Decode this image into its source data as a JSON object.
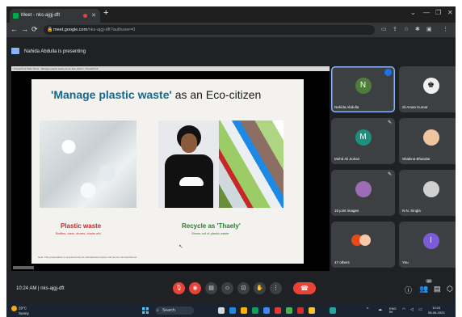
{
  "browser": {
    "tab_title": "Meet - nks-ajgj-dft",
    "new_tab": "+",
    "window_controls": [
      "⌄",
      "—",
      "❐",
      "✕"
    ],
    "nav": [
      "←",
      "→",
      "⟳"
    ],
    "url_host": "meet.google.com",
    "url_path": "/nks-ajgj-dft?authuser=0",
    "extensions": [
      "cast-icon",
      "share-icon",
      "star-icon",
      "extensions-icon",
      "sidebar-icon",
      "menu-icon"
    ]
  },
  "presenting": {
    "text": "Nahida Abdulla is presenting"
  },
  "screen": {
    "ppt_header": "PowerPoint Slide Show - Manage plastic waste as an Eco-citizen - PowerPoint",
    "slide": {
      "title_highlight": "'Manage plastic waste'",
      "title_rest": " as an Eco-citizen",
      "label_plastic": "Plastic waste",
      "sub_plastic": "Bottles, cans, drums, chairs etc.",
      "label_recycle": "Recycle as 'Thaely'",
      "sub_recycle": "Shoes out of plastic waste",
      "footnote": "Note: This presentation is prepared only for educational purpose and not for commercial use"
    }
  },
  "participants": [
    {
      "name": "Nahida Abdulla",
      "initial": "N",
      "color": "#4e7d3a",
      "active": true,
      "speaking": true
    },
    {
      "name": "Sl.Aman Kumar",
      "initial": "",
      "color": "#f0f0f0",
      "photo": true
    },
    {
      "name": "Mohd Ali Zuhair",
      "initial": "M",
      "color": "#1e8e7e"
    },
    {
      "name": "Shakina Bhandar",
      "initial": "",
      "color": "#efc5a0",
      "photo": true
    },
    {
      "name": "15 joint images",
      "initial": "",
      "color": "#9e6bb5",
      "photo": true
    },
    {
      "name": "N.N. Singla",
      "initial": "",
      "color": "#d0d0d0",
      "photo": true
    },
    {
      "name": "47 others",
      "initial": "",
      "color": "#e64a19",
      "group": true
    },
    {
      "name": "You",
      "initial": "I",
      "color": "#7b5cd6"
    }
  ],
  "controls": {
    "meeting_time": "10:24 AM",
    "meeting_code": "nks-ajgj-dft",
    "separator": "|",
    "buttons": [
      "mic-off",
      "camera-off",
      "captions",
      "emoji",
      "present",
      "raise-hand",
      "more"
    ],
    "end_label": "☎",
    "right": [
      "info-icon",
      "people-icon",
      "chat-icon",
      "activities-icon"
    ],
    "people_count": "49"
  },
  "taskbar": {
    "temp": "29°C",
    "weather": "Sunny",
    "search": "Search",
    "tray_items": [
      "^",
      "ENG",
      "IN"
    ],
    "time": "10:24",
    "date": "08-06-2023"
  }
}
